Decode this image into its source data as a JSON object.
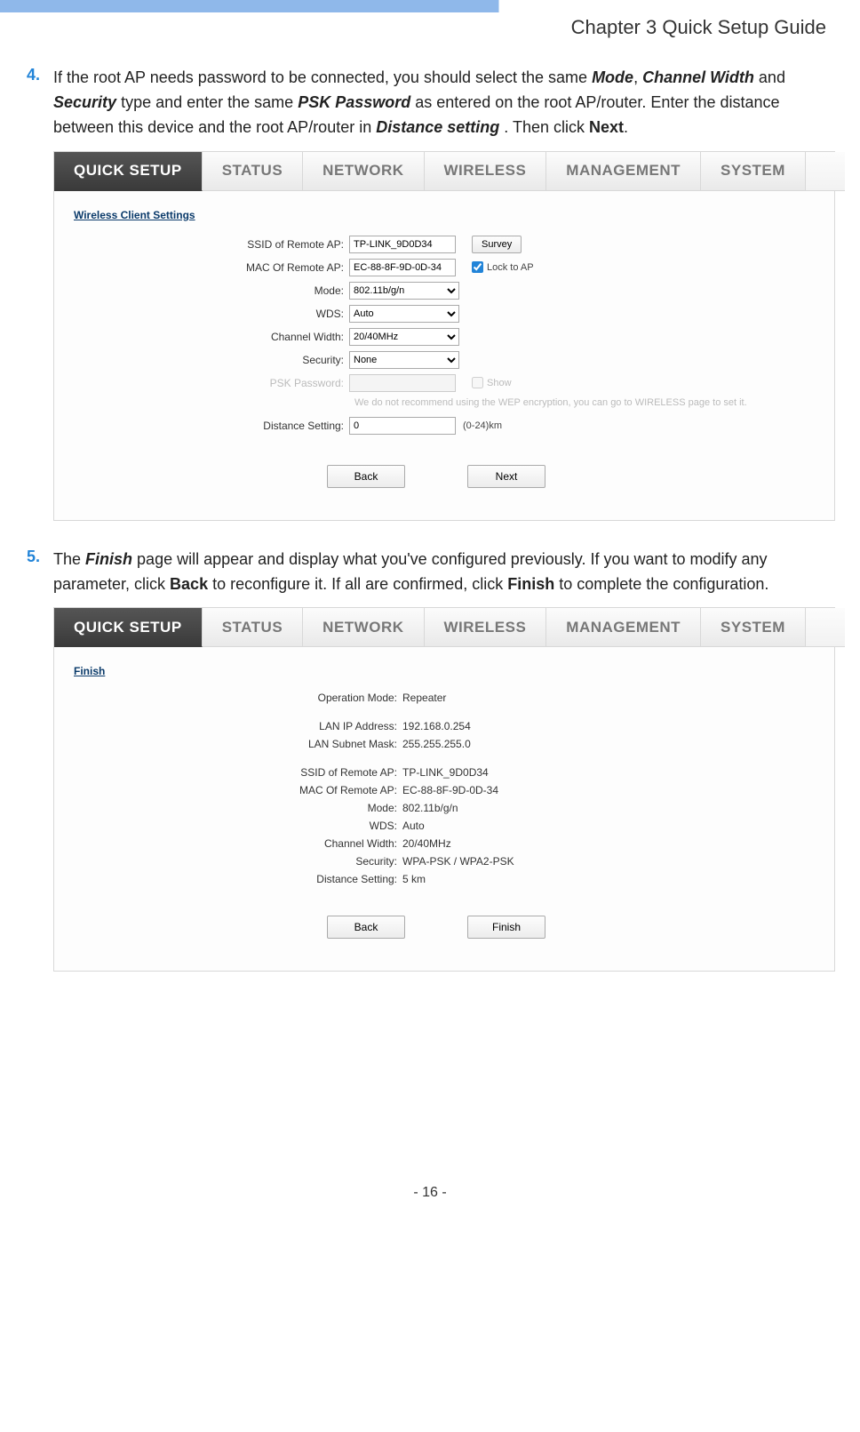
{
  "chapter_title": "Chapter 3 Quick Setup Guide",
  "steps": {
    "s4": {
      "num": "4.",
      "t1": "If the root AP needs password to be connected, you should select the same ",
      "mode": "Mode",
      "comma": ", ",
      "cw": "Channel Width",
      "t2": " and ",
      "sec": "Security",
      "t3": " type and enter the same ",
      "psk": "PSK Password",
      "t4": " as entered on the root AP/router. Enter the distance between this device and the root AP/router in ",
      "ds": "Distance setting",
      "t5": ". Then click ",
      "next": "Next",
      "t6": "."
    },
    "s5": {
      "num": "5.",
      "t1": "The ",
      "finish": "Finish",
      "t2": " page will appear and display what you've configured previously. If you want to modify any parameter, click ",
      "back": "Back",
      "t3": " to reconfigure it. If all are confirmed, click ",
      "finish2": "Finish",
      "t4": " to complete the configuration."
    }
  },
  "tabs": [
    "QUICK SETUP",
    "STATUS",
    "NETWORK",
    "WIRELESS",
    "MANAGEMENT",
    "SYSTEM"
  ],
  "panel1": {
    "title": "Wireless Client Settings",
    "rows": {
      "ssid": {
        "label": "SSID of Remote AP:",
        "value": "TP-LINK_9D0D34",
        "btn": "Survey"
      },
      "mac": {
        "label": "MAC Of Remote AP:",
        "value": "EC-88-8F-9D-0D-34",
        "chk": "Lock to AP"
      },
      "mode": {
        "label": "Mode:",
        "value": "802.11b/g/n"
      },
      "wds": {
        "label": "WDS:",
        "value": "Auto"
      },
      "cw": {
        "label": "Channel Width:",
        "value": "20/40MHz"
      },
      "sec": {
        "label": "Security:",
        "value": "None"
      },
      "psk": {
        "label": "PSK Password:",
        "value": "",
        "chk": "Show"
      },
      "note": "We do not recommend using the WEP encryption, you can go to WIRELESS page to set it.",
      "dist": {
        "label": "Distance Setting:",
        "value": "0",
        "unit": "(0-24)km"
      }
    },
    "btn_back": "Back",
    "btn_next": "Next"
  },
  "panel2": {
    "title": "Finish",
    "rows": [
      {
        "label": "Operation Mode:",
        "value": "Repeater"
      },
      {
        "gap": true
      },
      {
        "label": "LAN IP Address:",
        "value": "192.168.0.254"
      },
      {
        "label": "LAN Subnet Mask:",
        "value": "255.255.255.0"
      },
      {
        "gap": true
      },
      {
        "label": "SSID of Remote AP:",
        "value": "TP-LINK_9D0D34"
      },
      {
        "label": "MAC Of Remote AP:",
        "value": "EC-88-8F-9D-0D-34"
      },
      {
        "label": "Mode:",
        "value": "802.11b/g/n"
      },
      {
        "label": "WDS:",
        "value": "Auto"
      },
      {
        "label": "Channel Width:",
        "value": "20/40MHz"
      },
      {
        "label": "Security:",
        "value": "WPA-PSK / WPA2-PSK"
      },
      {
        "label": "Distance Setting:",
        "value": "5 km"
      }
    ],
    "btn_back": "Back",
    "btn_finish": "Finish"
  },
  "page_number": "- 16 -"
}
